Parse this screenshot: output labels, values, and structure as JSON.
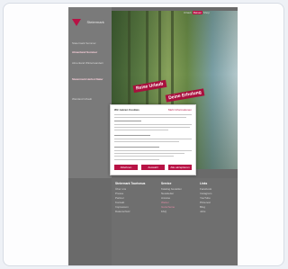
{
  "brand": {
    "name": "Steiermark",
    "accent": "#b81245"
  },
  "topnav": {
    "items": [
      "Urlaub",
      "Reisen",
      "Shop"
    ],
    "active": "Reisen"
  },
  "sidebar": {
    "items": [
      {
        "label": "Steiermark Sommer",
        "bold": false
      },
      {
        "label": "Almenland Sommer",
        "bold": true
      },
      {
        "label": "Almenland Winterwandern",
        "bold": false
      },
      {
        "label": "Steiermark Herbst Natur",
        "bold": true
      },
      {
        "label": "Weinland Urlaub",
        "bold": false
      }
    ]
  },
  "hero": {
    "stamps": [
      "Reise Urlaub",
      "Deine Erholung"
    ]
  },
  "cookie_modal": {
    "title": "Wir nutzen Cookies",
    "link": "Mehr Informationen",
    "buttons": [
      "Ablehnen",
      "Auswahl",
      "Alle akzeptieren"
    ]
  },
  "footer": {
    "headings": [
      "Steiermark Tourismus",
      "Service",
      "Links"
    ],
    "columns": [
      [
        "Über uns",
        "Presse",
        "Partner",
        "Kontakt",
        "Impressum",
        "Datenschutz"
      ],
      [
        "Katalog bestellen",
        "Newsletter",
        "Anreise",
        "Wetter",
        "Gutscheine",
        "FAQ"
      ],
      [
        "Facebook",
        "Instagram",
        "YouTube",
        "Pinterest",
        "Blog",
        "Jobs"
      ]
    ]
  }
}
